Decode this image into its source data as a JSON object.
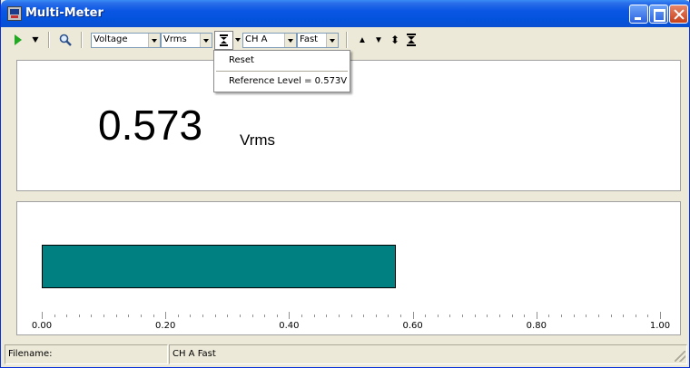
{
  "window": {
    "title": "Multi-Meter"
  },
  "toolbar": {
    "measurement": "Voltage",
    "unit_mode": "Vrms",
    "channel": "CH A",
    "speed": "Fast"
  },
  "menu": {
    "items": [
      {
        "label": "Reset"
      },
      {
        "label": "Reference Level = 0.573V"
      }
    ]
  },
  "reading": {
    "value": "0.573",
    "unit": "Vrms"
  },
  "meter": {
    "value": 0.573,
    "min": 0,
    "max": 1.0,
    "tick_labels": [
      "0.00",
      "0.20",
      "0.40",
      "0.60",
      "0.80",
      "1.00"
    ],
    "bar_color": "#008080"
  },
  "status": {
    "filename_label": "Filename:",
    "channel_info": "CH A  Fast"
  }
}
